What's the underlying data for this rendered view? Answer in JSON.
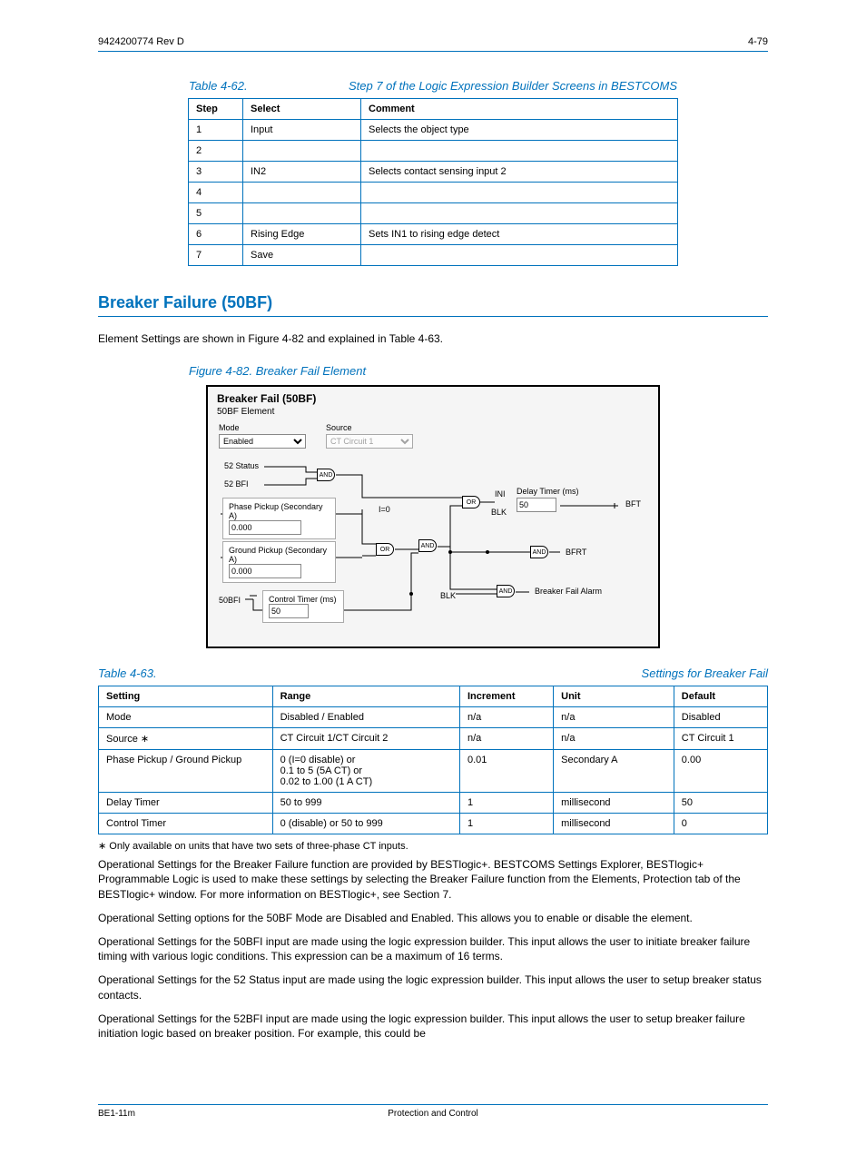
{
  "header": {
    "left": "9424200774 Rev D",
    "right": "4-79"
  },
  "section_hdr": {
    "title": "Breaker Failure (50BF)"
  },
  "intro_para": "Element Settings are shown in Figure 4-82 and explained in Table 4-63.",
  "table1": {
    "caption": "Step 7 of the Logic Expression Builder Screens in BESTCOMS",
    "number": "Table 4-62.",
    "headers": [
      "Step",
      "Select",
      "Comment"
    ],
    "rows": [
      [
        "1",
        "Input",
        "Selects the object type"
      ],
      [
        "2",
        " ",
        " "
      ],
      [
        "3",
        "IN2",
        "Selects contact sensing input 2"
      ],
      [
        "4",
        " ",
        " "
      ],
      [
        "5",
        " ",
        " "
      ],
      [
        "6",
        "Rising Edge",
        "Sets IN1 to rising edge detect"
      ],
      [
        "7",
        "Save",
        " "
      ]
    ]
  },
  "figure": {
    "caption": "Figure 4-82.   Breaker Fail Element",
    "panel_title": "Breaker Fail (50BF)",
    "sub": "50BF Element",
    "mode_label": "Mode",
    "mode_value": "Enabled",
    "source_label": "Source",
    "source_value": "CT Circuit 1",
    "status_52": "52 Status",
    "bfi_52": "52 BFI",
    "phase_box_label": "Phase Pickup (Secondary A)",
    "phase_val": "0.000",
    "ground_box_label": "Ground Pickup (Secondary A)",
    "ground_val": "0.000",
    "i0": "I=0",
    "control_timer_label": "Control Timer (ms)",
    "control_timer_val": "50",
    "bfi_50": "50BFI",
    "delay_timer_label": "Delay Timer (ms)",
    "delay_timer_val": "50",
    "ini": "INI",
    "blk1": "BLK",
    "blk2": "BLK",
    "bft": "BFT",
    "bfrt": "BFRT",
    "bfa": "Breaker Fail Alarm",
    "g_and": "AND",
    "g_or": "OR"
  },
  "table2": {
    "caption_row": {
      "caption": "Settings for Breaker Fail",
      "number": "Table 4-63."
    },
    "headers": [
      "Setting",
      "Range",
      "Increment",
      "Unit",
      "Default"
    ],
    "rows": [
      [
        "Mode",
        "Disabled / Enabled",
        "n/a",
        "n/a",
        "Disabled"
      ],
      [
        "Source ∗",
        "CT Circuit 1/CT Circuit 2",
        "n/a",
        "n/a",
        "CT Circuit 1"
      ],
      [
        "Phase Pickup / Ground Pickup",
        "0 (I=0 disable) or\n0.1 to 5 (5A CT) or\n0.02 to 1.00 (1 A CT)",
        "0.01",
        "Secondary A",
        "0.00"
      ],
      [
        "Delay Timer",
        "50 to 999",
        "1",
        "millisecond",
        "50"
      ],
      [
        "Control Timer",
        "0 (disable) or 50 to 999",
        "1",
        "millisecond",
        "0"
      ]
    ],
    "footnote": "∗ Only available on units that have two sets of three-phase CT inputs."
  },
  "op1": "Operational Settings for the Breaker Failure function are provided by BESTlogic+. BESTCOMS Settings Explorer, BESTlogic+ Programmable Logic is used to make these settings by selecting the Breaker Failure function from the Elements, Protection tab of the BESTlogic+ window. For more information on BESTlogic+, see Section 7.",
  "op2": "Operational Setting options for the 50BF Mode are Disabled and Enabled. This allows you to enable or disable the element.",
  "op3": "Operational Settings for the 50BFI input are made using the logic expression builder. This input allows the user to initiate breaker failure timing with various logic conditions. This expression can be a maximum of 16 terms.",
  "op4": "Operational Settings for the 52 Status input are made using the logic expression builder. This input allows the user to setup breaker status contacts.",
  "op5": "Operational Settings for the 52BFI input are made using the logic expression builder. This input allows the user to setup breaker failure initiation logic based on breaker position. For example, this could be",
  "footer": {
    "left": "BE1-11m",
    "center": "Protection and Control",
    "right": ""
  }
}
